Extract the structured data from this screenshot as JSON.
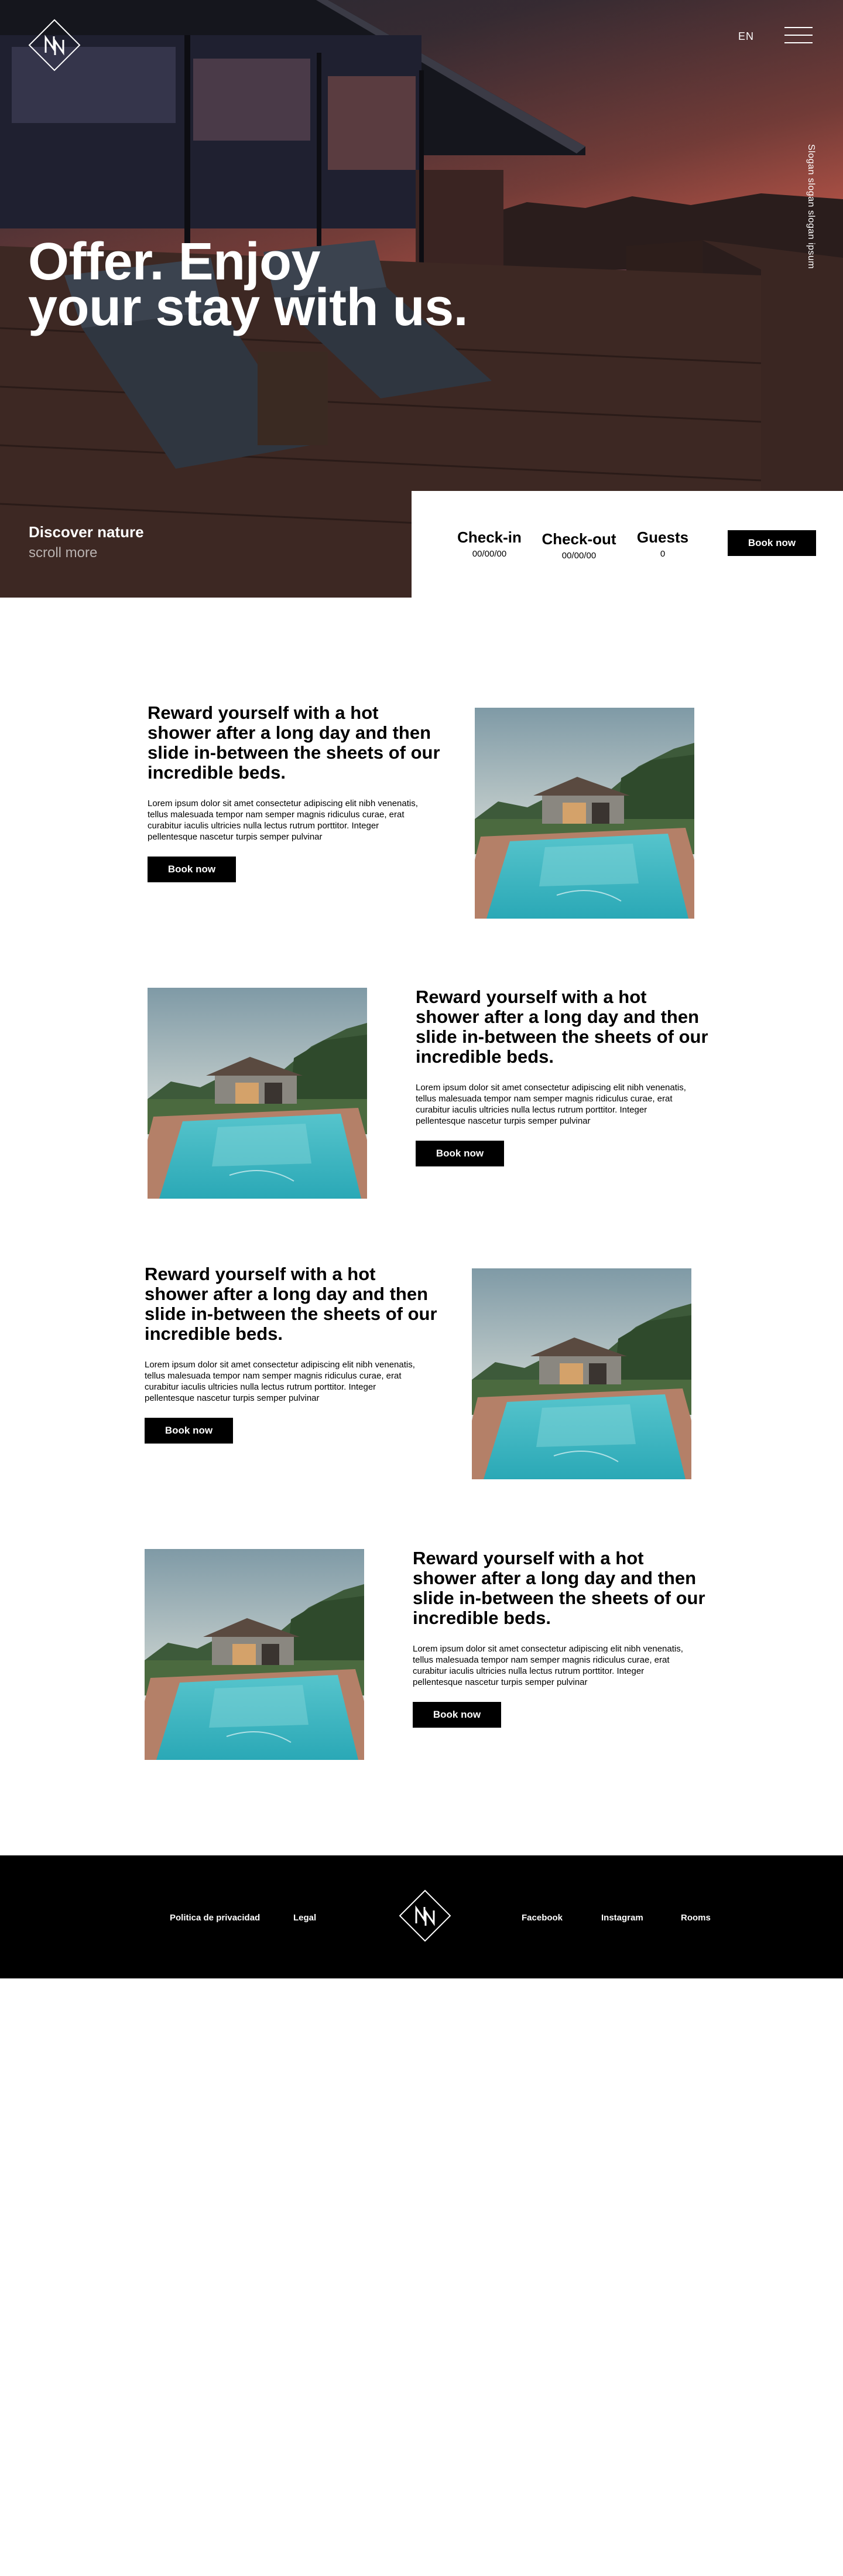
{
  "header": {
    "brand_logo": "NN-monogram",
    "language": "EN",
    "menu_icon": "hamburger-icon",
    "slogan": "Slogan slogan slogan ipsum"
  },
  "hero": {
    "title_line1": "Offer. Enjoy",
    "title_line2": "your stay with us.",
    "discover_title": "Discover nature",
    "discover_subtitle": "scroll more"
  },
  "booking": {
    "checkin_label": "Check-in",
    "checkin_value": "00/00/00",
    "checkout_label": "Check-out",
    "checkout_value": "00/00/00",
    "guests_label": "Guests",
    "guests_value": "0",
    "button_label": "Book now"
  },
  "features": [
    {
      "heading": "Reward yourself with a hot shower after a long day and then slide in-between the sheets of our incredible beds.",
      "body": "Lorem ipsum dolor sit amet consectetur adipiscing elit nibh venenatis, tellus malesuada tempor nam semper magnis ridiculus curae, erat curabitur iaculis ultricies nulla lectus rutrum porttitor. Integer pellentesque nascetur turpis semper pulvinar",
      "button": "Book now"
    },
    {
      "heading": "Reward yourself with a hot shower after a long day and then slide in-between the sheets of our incredible beds.",
      "body": "Lorem ipsum dolor sit amet consectetur adipiscing elit nibh venenatis, tellus malesuada tempor nam semper magnis ridiculus curae, erat curabitur iaculis ultricies nulla lectus rutrum porttitor. Integer pellentesque nascetur turpis semper pulvinar",
      "button": "Book now"
    },
    {
      "heading": "Reward yourself with a hot shower after a long day and then slide in-between the sheets of our incredible beds.",
      "body": "Lorem ipsum dolor sit amet consectetur adipiscing elit nibh venenatis, tellus malesuada tempor nam semper magnis ridiculus curae, erat curabitur iaculis ultricies nulla lectus rutrum porttitor. Integer pellentesque nascetur turpis semper pulvinar",
      "button": "Book now"
    },
    {
      "heading": "Reward yourself with a hot shower after a long day and then slide in-between the sheets of our incredible beds.",
      "body": "Lorem ipsum dolor sit amet consectetur adipiscing elit nibh venenatis, tellus malesuada tempor nam semper magnis ridiculus curae, erat curabitur iaculis ultricies nulla lectus rutrum porttitor. Integer pellentesque nascetur turpis semper pulvinar",
      "button": "Book now"
    }
  ],
  "footer": {
    "links_left": [
      "Politica de privacidad",
      "Legal"
    ],
    "links_right": [
      "Facebook",
      "Instagram",
      "Rooms"
    ]
  },
  "colors": {
    "primary": "#000000",
    "background": "#ffffff",
    "sky_accent": "#e07a5c",
    "pool_water": "#3bb8c4"
  }
}
